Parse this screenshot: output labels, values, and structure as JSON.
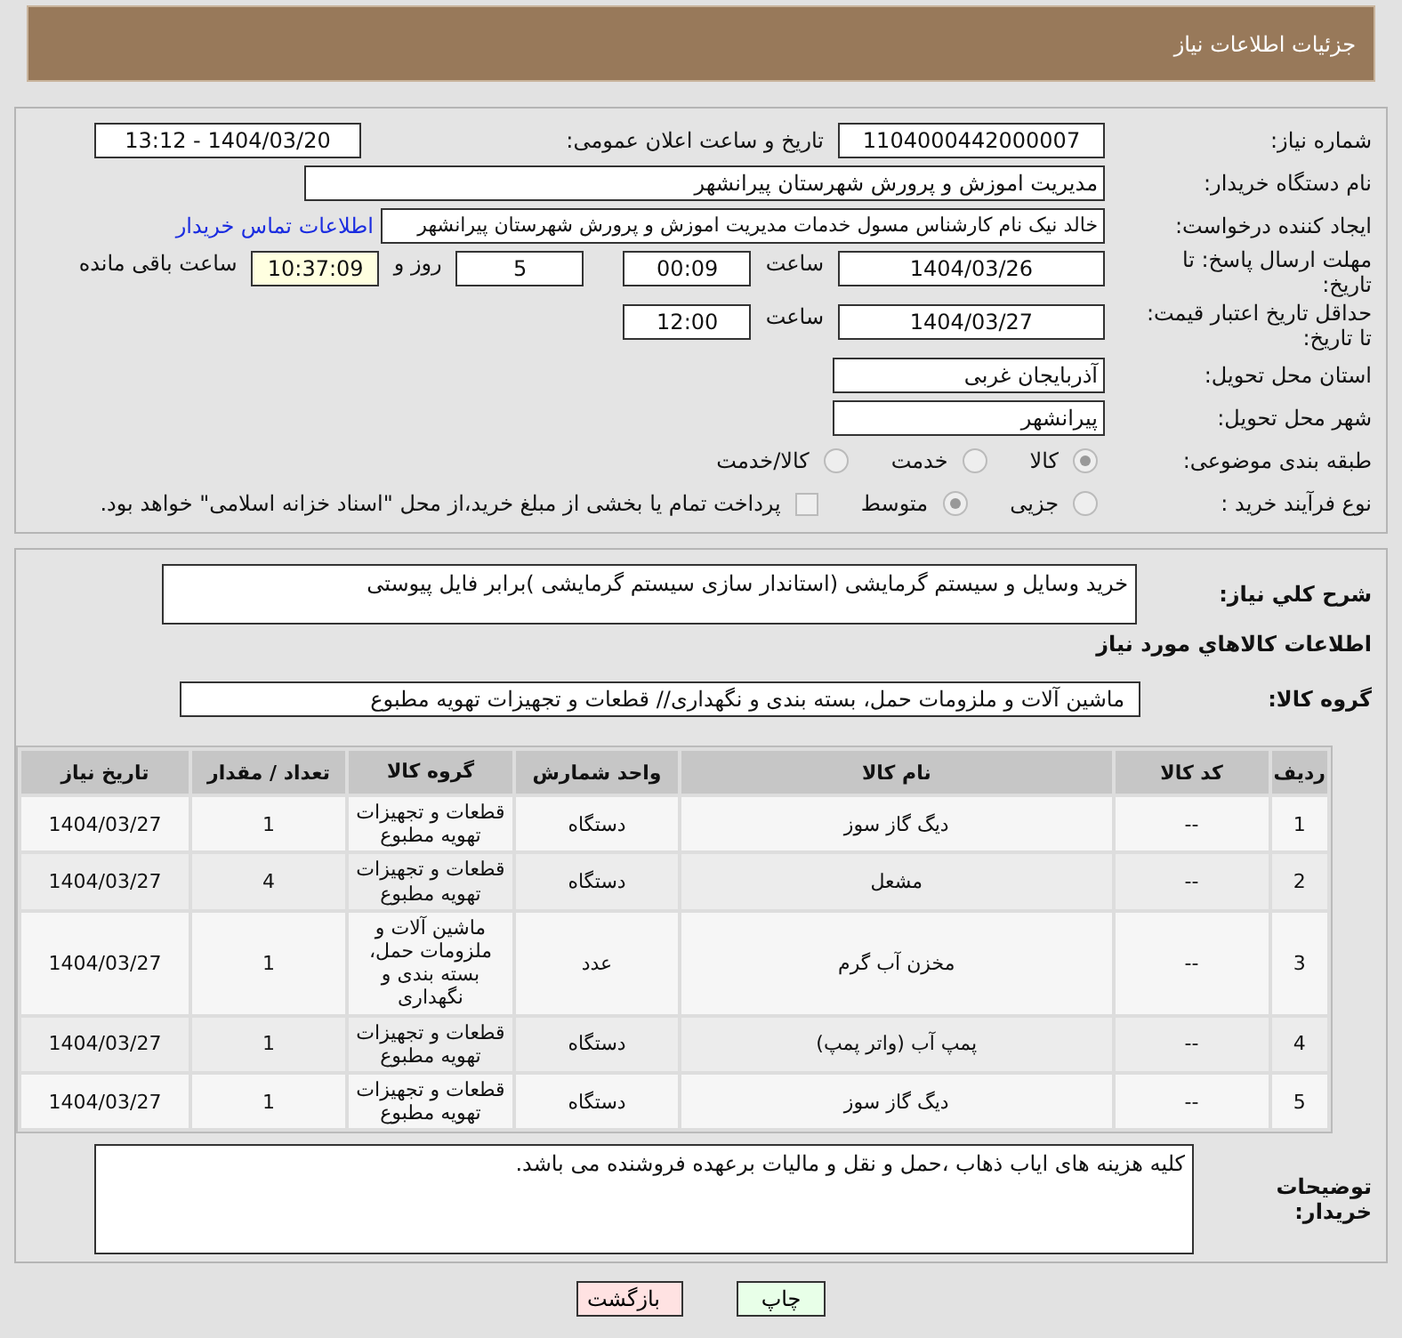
{
  "header": {
    "title": "جزئیات اطلاعات نیاز"
  },
  "need_number": {
    "label": "شماره نیاز:",
    "value": "1104000442000007"
  },
  "announce": {
    "label": "تاریخ و ساعت اعلان عمومی:",
    "value": "1404/03/20 - 13:12"
  },
  "buyer": {
    "label": "نام دستگاه خریدار:",
    "value": "مدیریت اموزش و پرورش شهرستان پیرانشهر"
  },
  "requester": {
    "label": "ایجاد کننده درخواست:",
    "value": "خالد نیک نام کارشناس مسول خدمات مدیریت اموزش و پرورش شهرستان پیرانشهر",
    "link": "اطلاعات تماس خریدار"
  },
  "deadline": {
    "label": "مهلت ارسال پاسخ: تا تاریخ:",
    "date": "1404/03/26",
    "time_label": "ساعت",
    "time": "00:09",
    "days": "5",
    "days_label": "روز و",
    "remaining": "10:37:09",
    "remaining_label": "ساعت باقی مانده"
  },
  "validity": {
    "label": "حداقل تاریخ اعتبار قیمت: تا تاریخ:",
    "date": "1404/03/27",
    "time_label": "ساعت",
    "time": "12:00"
  },
  "province": {
    "label": "استان محل تحویل:",
    "value": "آذربایجان غربی"
  },
  "city": {
    "label": "شهر محل تحویل:",
    "value": "پیرانشهر"
  },
  "category": {
    "label": "طبقه بندی موضوعی:",
    "options": [
      {
        "label": "کالا",
        "selected": true
      },
      {
        "label": "خدمت",
        "selected": false
      },
      {
        "label": "کالا/خدمت",
        "selected": false
      }
    ]
  },
  "process": {
    "label": "نوع فرآیند خرید :",
    "options": [
      {
        "label": "جزیی",
        "selected": false
      },
      {
        "label": "متوسط",
        "selected": true
      }
    ],
    "checkbox": {
      "label": "پرداخت تمام یا بخشی از مبلغ خرید،از محل \"اسناد خزانه اسلامی\" خواهد بود.",
      "checked": false
    }
  },
  "description": {
    "label": "شرح کلي نياز:",
    "value": "خرید وسایل و سیستم گرمایشی (استاندار سازی سیستم گرمایشی )برابر فایل پیوستی"
  },
  "goods": {
    "title": "اطلاعات کالاهاي مورد نياز",
    "group_label": "گروه کالا:",
    "group_value": "ماشین آلات و ملزومات حمل، بسته بندی و نگهداری//  قطعات و تجهیزات تهویه مطبوع",
    "columns": [
      "ردیف",
      "کد کالا",
      "نام کالا",
      "واحد شمارش",
      "گروه کالا",
      "تعداد / مقدار",
      "تاریخ نیاز"
    ],
    "rows": [
      [
        "1",
        "--",
        "دیگ گاز سوز",
        "دستگاه",
        "قطعات و تجهیزات تهویه مطبوع",
        "1",
        "1404/03/27"
      ],
      [
        "2",
        "--",
        "مشعل",
        "دستگاه",
        "قطعات و تجهیزات تهویه مطبوع",
        "4",
        "1404/03/27"
      ],
      [
        "3",
        "--",
        "مخزن آب گرم",
        "عدد",
        "ماشین آلات و ملزومات حمل، بسته بندی و نگهداری",
        "1",
        "1404/03/27"
      ],
      [
        "4",
        "--",
        "پمپ آب (واتر پمپ)",
        "دستگاه",
        "قطعات و تجهیزات تهویه مطبوع",
        "1",
        "1404/03/27"
      ],
      [
        "5",
        "--",
        "دیگ گاز سوز",
        "دستگاه",
        "قطعات و تجهیزات تهویه مطبوع",
        "1",
        "1404/03/27"
      ]
    ]
  },
  "buyer_notes": {
    "label": "توضیحات خریدار:",
    "value": "کلیه هزینه های ایاب ذهاب ،حمل و نقل و مالیات برعهده فروشنده می باشد."
  },
  "buttons": [
    {
      "label": "چاپ",
      "kind": "print"
    },
    {
      "label": "بازگشت",
      "kind": "back"
    }
  ]
}
